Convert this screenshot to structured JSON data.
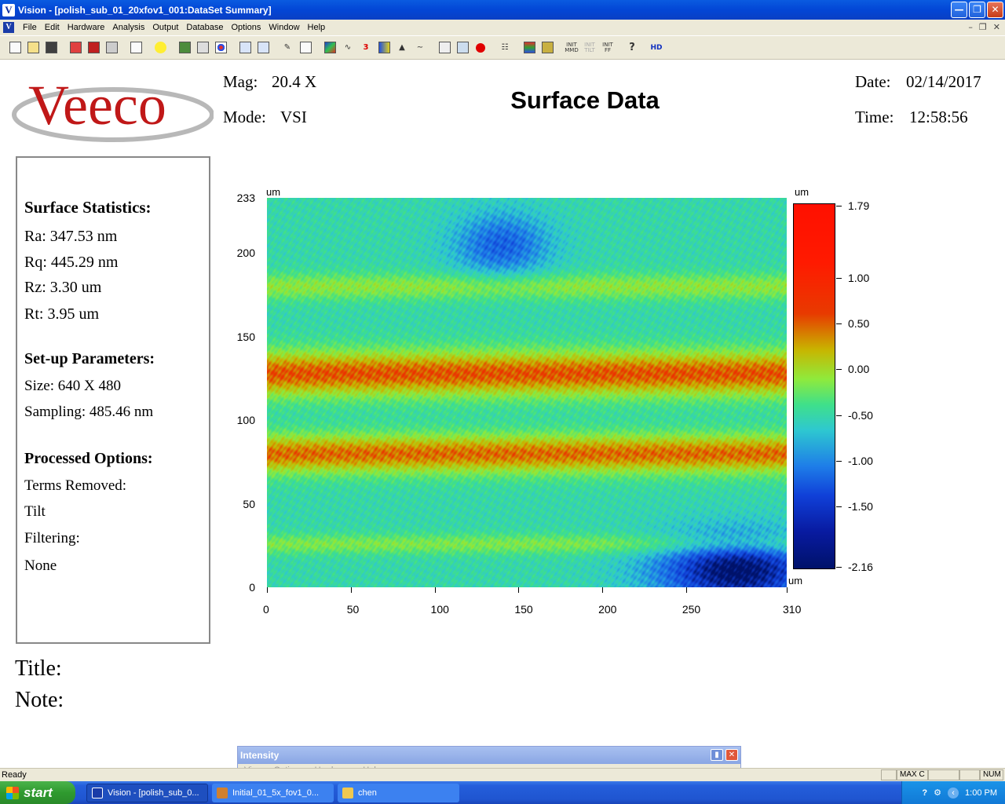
{
  "window": {
    "title": "Vision - [polish_sub_01_20xfov1_001:DataSet Summary]",
    "app_icon": "V",
    "controls": [
      "minimize",
      "restore",
      "close"
    ]
  },
  "menu": {
    "items": [
      "File",
      "Edit",
      "Hardware",
      "Analysis",
      "Output",
      "Database",
      "Options",
      "Window",
      "Help"
    ],
    "doc_icon": "V"
  },
  "toolbar": {
    "icons": [
      "new-icon",
      "open-icon",
      "save-icon",
      "print-red-icon",
      "save-red-icon",
      "print-icon",
      "page-icon",
      "light-icon",
      "database-icon",
      "db-grid-icon",
      "dots-icon",
      "table-icon",
      "table2-icon",
      "ruler-icon",
      "copy-icon",
      "color-map-icon",
      "line-plot-icon",
      "3d-icon",
      "histogram-icon",
      "peak-icon",
      "curve-icon",
      "stage-icon",
      "chart-icon",
      "record-icon",
      "filter-icon",
      "tool-icon",
      "intensity-icon",
      "init-mmd-icon",
      "init-tilt-icon",
      "init-ff-icon",
      "help-icon",
      "hd-icon"
    ],
    "labels": {
      "init_mmd": "INIT MMD",
      "init_tilt": "INIT TILT",
      "init_ff": "INIT FF",
      "help": "?",
      "hd": "HD"
    }
  },
  "header": {
    "logo_text": "Veeco",
    "mag_label": "Mag:",
    "mag_value": "20.4 X",
    "mode_label": "Mode:",
    "mode_value": "VSI",
    "title": "Surface Data",
    "date_label": "Date:",
    "date_value": "02/14/2017",
    "time_label": "Time:",
    "time_value": "12:58:56"
  },
  "stats": {
    "surface_heading": "Surface Statistics:",
    "ra": "Ra:  347.53 nm",
    "rq": "Rq:  445.29 nm",
    "rz": "Rz:  3.30 um",
    "rt": "Rt:  3.95 um",
    "setup_heading": "Set-up Parameters:",
    "size": "Size: 640 X 480",
    "sampling": "Sampling:  485.46 nm",
    "processed_heading": "Processed Options:",
    "terms_label": "Terms Removed:",
    "terms_value": "Tilt",
    "filtering_label": "Filtering:",
    "filtering_value": "None"
  },
  "notes": {
    "title_label": "Title:",
    "note_label": "Note:"
  },
  "chart_data": {
    "type": "heatmap",
    "title": "Surface Data",
    "x_unit": "um",
    "y_unit": "um",
    "z_unit": "um",
    "xlim": [
      0,
      310
    ],
    "ylim": [
      0,
      233
    ],
    "zlim": [
      -2.16,
      1.79
    ],
    "x_ticks": [
      "0",
      "50",
      "100",
      "150",
      "200",
      "250",
      "310"
    ],
    "y_ticks": [
      "0",
      "50",
      "100",
      "150",
      "200",
      "233"
    ],
    "colorbar_ticks": [
      "1.79",
      "1.00",
      "0.50",
      "0.00",
      "-0.50",
      "-1.00",
      "-1.50",
      "-2.16"
    ],
    "colorbar_tick_values": [
      1.79,
      1.0,
      0.5,
      0.0,
      -0.5,
      -1.0,
      -1.5,
      -2.16
    ],
    "colormap": [
      "#00126a",
      "#1040d8",
      "#1e7de8",
      "#2ec8d0",
      "#3fe08a",
      "#8fea3c",
      "#c8b500",
      "#e83a00",
      "#ff1a00"
    ],
    "bands": [
      {
        "y_center": 128,
        "y_halfwidth": 14,
        "level": 1.2
      },
      {
        "y_center": 80,
        "y_halfwidth": 12,
        "level": 1.1
      },
      {
        "y_center": 180,
        "y_halfwidth": 8,
        "level": 0.3
      },
      {
        "y_center": 26,
        "y_halfwidth": 6,
        "level": 0.2
      }
    ],
    "low_regions": [
      {
        "x_center": 280,
        "y_center": 10,
        "x_halfwidth": 50,
        "y_halfwidth": 22,
        "level": -2.0
      },
      {
        "x_center": 140,
        "y_center": 205,
        "x_halfwidth": 30,
        "y_halfwidth": 20,
        "level": -1.2
      }
    ]
  },
  "intensity_window": {
    "title": "Intensity",
    "menu": [
      "View",
      "Options",
      "Hardware",
      "Help"
    ]
  },
  "statusbar": {
    "left": "Ready",
    "max_c": "MAX C",
    "num": "NUM"
  },
  "taskbar": {
    "start_label": "start",
    "tasks": [
      {
        "label": "Vision - [polish_sub_0...",
        "icon": "vision-icon",
        "color": "#1a3ca8"
      },
      {
        "label": "Initial_01_5x_fov1_0...",
        "icon": "image-icon",
        "color": "#d08030"
      },
      {
        "label": "chen",
        "icon": "folder-icon",
        "color": "#f0c850"
      }
    ],
    "clock": "1:00 PM"
  }
}
